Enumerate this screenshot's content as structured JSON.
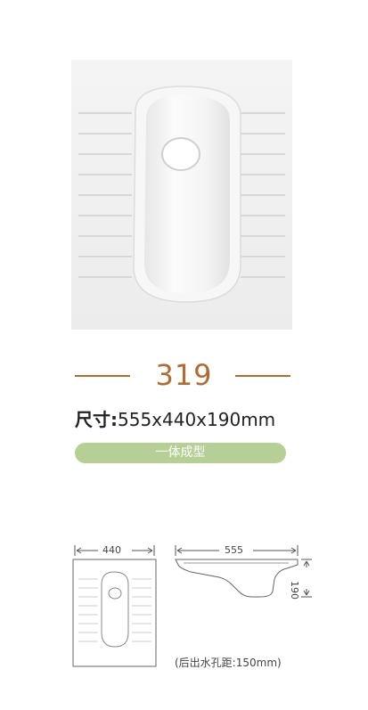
{
  "product": {
    "model": "319",
    "size_label": "尺寸:",
    "size_value": "555x440x190mm",
    "type_badge": "一体成型"
  },
  "drawings": {
    "top_view_width": "440",
    "side_view_length": "555",
    "side_view_height": "190"
  },
  "note": "(后出水孔距:150mm)",
  "colors": {
    "accent": "#b06d2f",
    "badge": "#b6cf94",
    "text": "#222222"
  }
}
